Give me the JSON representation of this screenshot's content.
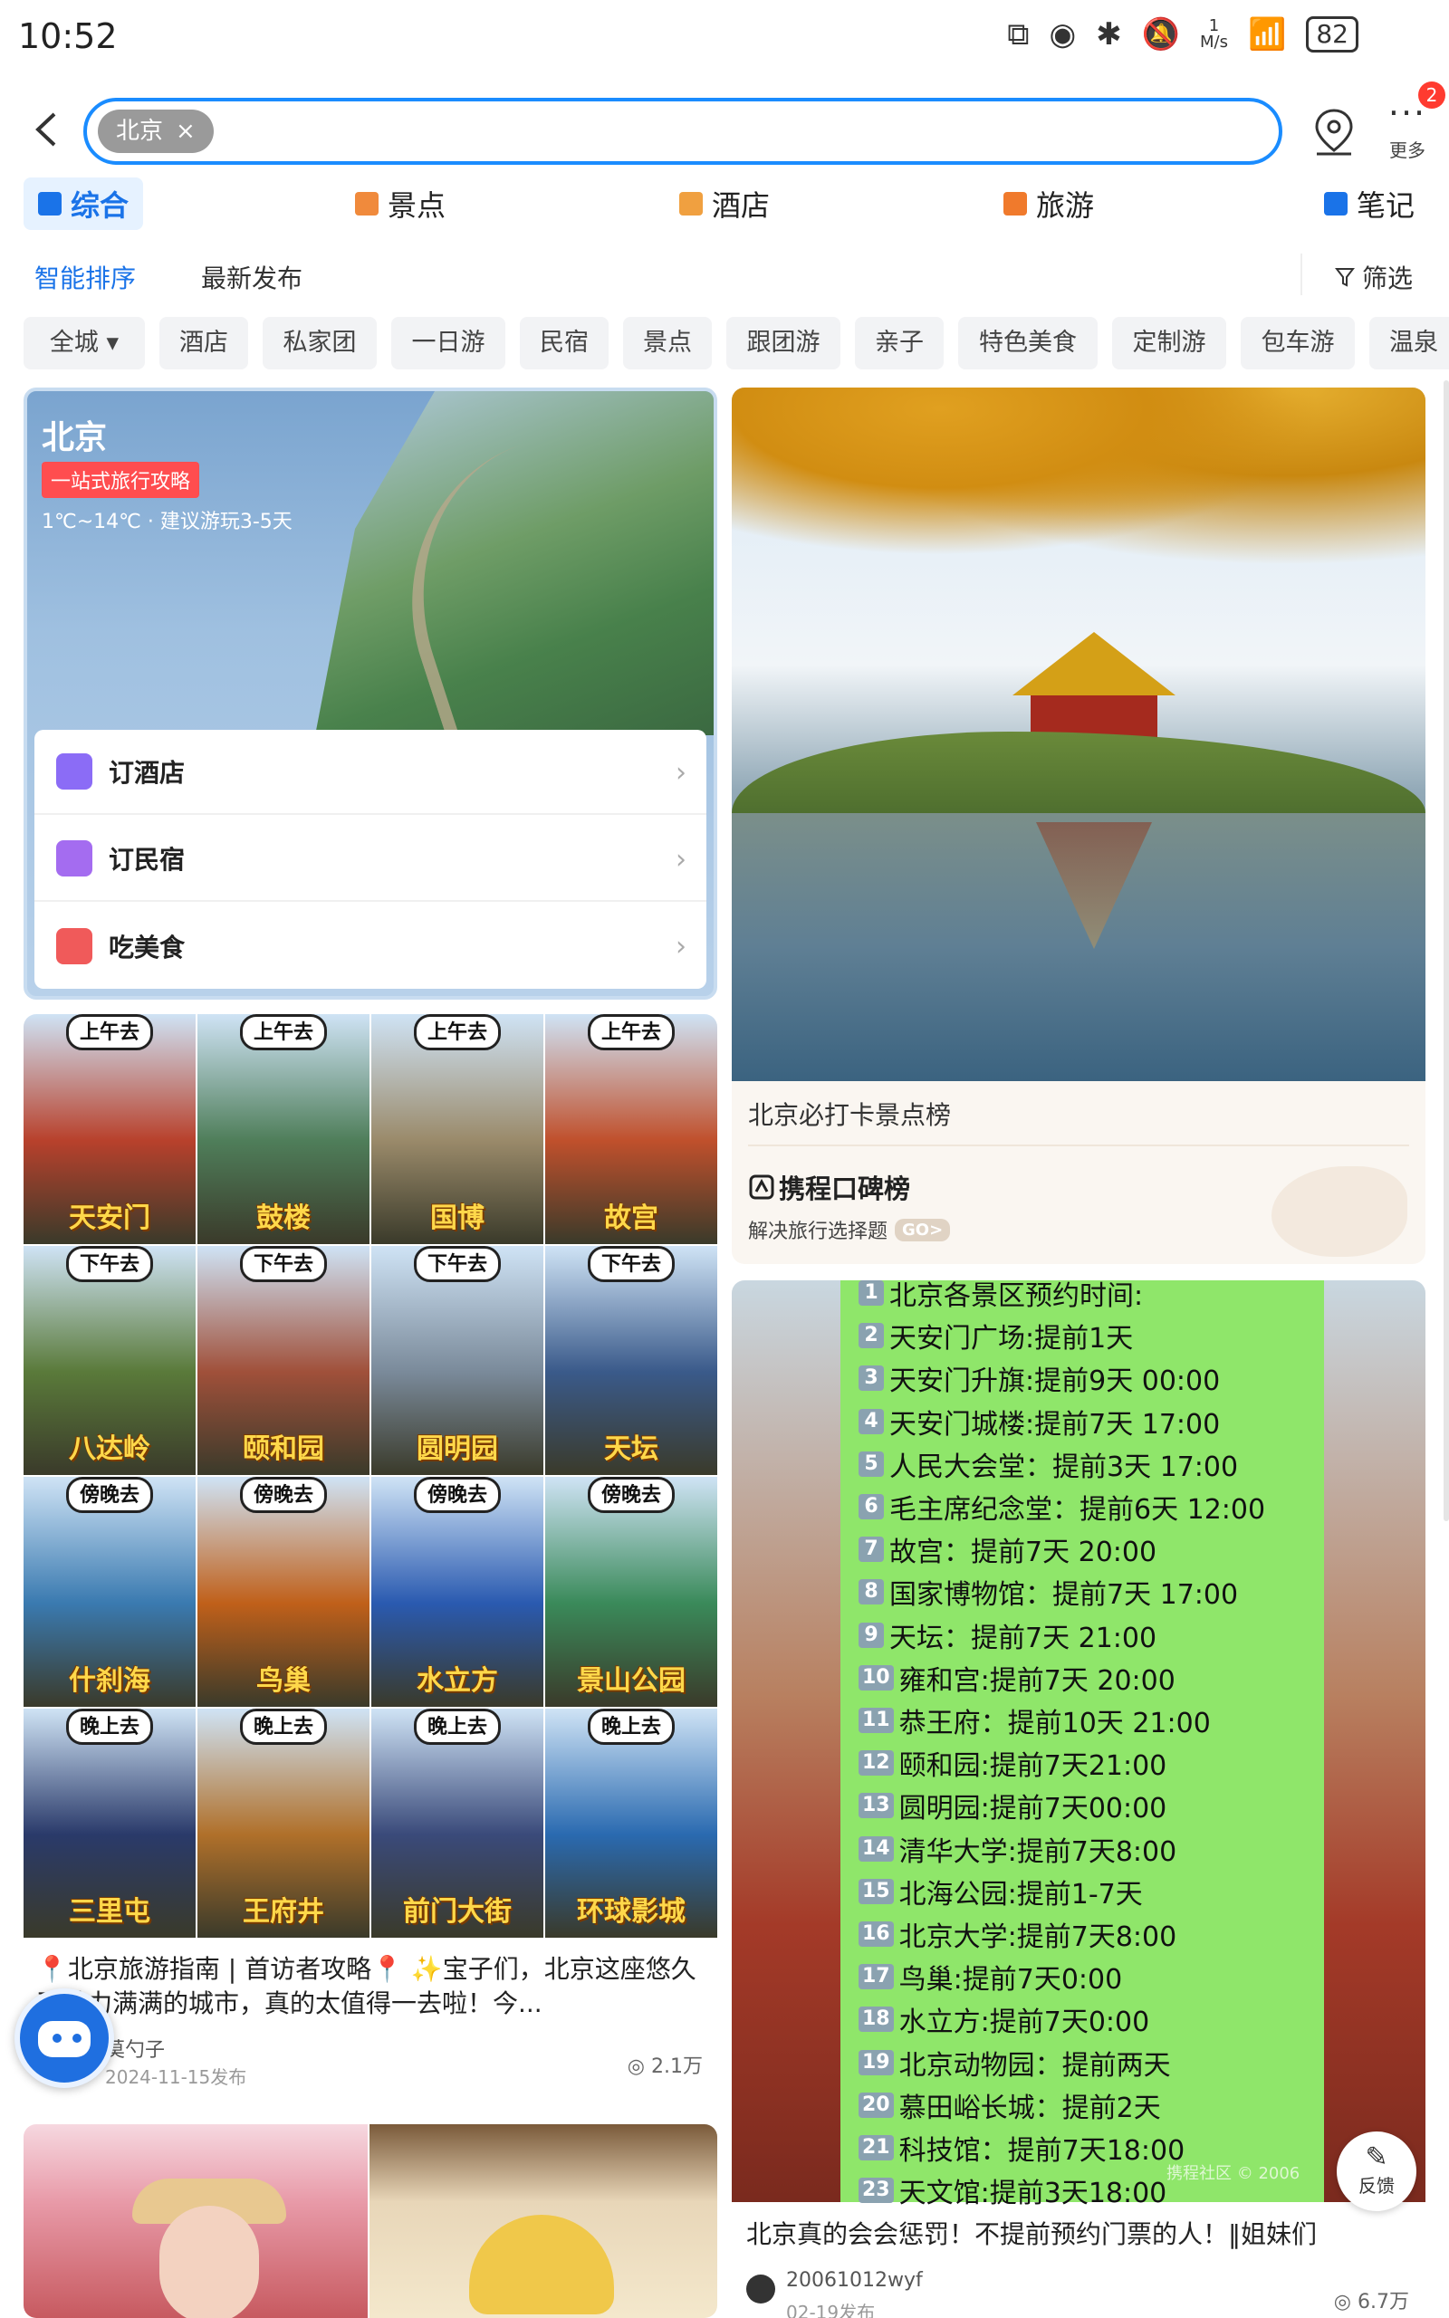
{
  "status_bar": {
    "time": "10:52",
    "net_speed_value": "1",
    "net_speed_unit": "M/s",
    "battery": "82"
  },
  "search": {
    "chip_label": "北京",
    "chip_close": "×"
  },
  "more": {
    "label": "更多",
    "badge": "2"
  },
  "category_tabs": [
    {
      "label": "综合",
      "active": true,
      "icon_color": "#1a73e8"
    },
    {
      "label": "景点",
      "icon_color": "#f08a3c"
    },
    {
      "label": "酒店",
      "icon_color": "#f0a040"
    },
    {
      "label": "旅游",
      "icon_color": "#f07a2c"
    },
    {
      "label": "笔记",
      "icon_color": "#1a73e8"
    }
  ],
  "sort": {
    "smart": "智能排序",
    "latest": "最新发布",
    "filter": "筛选"
  },
  "filter_chips": [
    "全城",
    "酒店",
    "私家团",
    "一日游",
    "民宿",
    "景点",
    "跟团游",
    "亲子",
    "特色美食",
    "定制游",
    "包车游",
    "温泉"
  ],
  "beijing_card": {
    "title": "北京",
    "tag": "一站式旅行攻略",
    "weather": "1℃~14℃ · 建议游玩3-5天",
    "links": [
      {
        "label": "订酒店",
        "icon_color": "#8b6cf6"
      },
      {
        "label": "订民宿",
        "icon_color": "#a46cf0"
      },
      {
        "label": "吃美食",
        "icon_color": "#f05a5a"
      }
    ]
  },
  "forbidden_card": {
    "title": "北京必打卡景点榜",
    "brand": "携程口碑榜",
    "subtitle": "解决旅行选择题",
    "go": "GO>"
  },
  "guide_card": {
    "tiles": [
      {
        "tag": "上午去",
        "name": "天安门",
        "color": "#b8412c"
      },
      {
        "tag": "上午去",
        "name": "鼓楼",
        "color": "#4f7e5a"
      },
      {
        "tag": "上午去",
        "name": "国博",
        "color": "#9a8a6a"
      },
      {
        "tag": "上午去",
        "name": "故宫",
        "color": "#c0502c"
      },
      {
        "tag": "下午去",
        "name": "八达岭",
        "color": "#5a7a3a"
      },
      {
        "tag": "下午去",
        "name": "颐和园",
        "color": "#a0503a"
      },
      {
        "tag": "下午去",
        "name": "圆明园",
        "color": "#7a8a9a"
      },
      {
        "tag": "下午去",
        "name": "天坛",
        "color": "#3a5a8a"
      },
      {
        "tag": "傍晚去",
        "name": "什刹海",
        "color": "#3a7ab0"
      },
      {
        "tag": "傍晚去",
        "name": "鸟巢",
        "color": "#c0601a"
      },
      {
        "tag": "傍晚去",
        "name": "水立方",
        "color": "#2a5ab0"
      },
      {
        "tag": "傍晚去",
        "name": "景山公园",
        "color": "#3a8a5a"
      },
      {
        "tag": "晚上去",
        "name": "三里屯",
        "color": "#2a3a6a"
      },
      {
        "tag": "晚上去",
        "name": "王府井",
        "color": "#b0702a"
      },
      {
        "tag": "晚上去",
        "name": "前门大街",
        "color": "#3a4a7a"
      },
      {
        "tag": "晚上去",
        "name": "环球影城",
        "color": "#2a6ab0"
      }
    ],
    "text": "📍北京旅游指南 | 首访者攻略📍 ✨宝子们，北京这座悠久又魅力满满的城市，真的太值得一去啦！今...",
    "author": "莫勺子",
    "date": "2024-11-15发布",
    "views": "2.1万"
  },
  "list_card": {
    "rows": [
      {
        "num": "1",
        "text": "北京各景区预约时间:"
      },
      {
        "num": "2",
        "text": "天安门广场:提前1天"
      },
      {
        "num": "3",
        "text": "天安门升旗:提前9天 00:00"
      },
      {
        "num": "4",
        "text": "天安门城楼:提前7天 17:00"
      },
      {
        "num": "5",
        "text": "人民大会堂：提前3天 17:00"
      },
      {
        "num": "6",
        "text": "毛主席纪念堂：提前6天 12:00"
      },
      {
        "num": "7",
        "text": "故宫：提前7天 20:00"
      },
      {
        "num": "8",
        "text": "国家博物馆：提前7天 17:00"
      },
      {
        "num": "9",
        "text": "天坛：提前7天 21:00"
      },
      {
        "num": "10",
        "text": "雍和宫:提前7天 20:00"
      },
      {
        "num": "11",
        "text": "恭王府：提前10天 21:00"
      },
      {
        "num": "12",
        "text": "颐和园:提前7天21:00"
      },
      {
        "num": "13",
        "text": "圆明园:提前7天00:00"
      },
      {
        "num": "14",
        "text": "清华大学:提前7天8:00"
      },
      {
        "num": "15",
        "text": "北海公园:提前1-7天"
      },
      {
        "num": "16",
        "text": "北京大学:提前7天8:00"
      },
      {
        "num": "17",
        "text": "鸟巢:提前7天0:00"
      },
      {
        "num": "18",
        "text": "水立方:提前7天0:00"
      },
      {
        "num": "19",
        "text": "北京动物园：提前两天"
      },
      {
        "num": "20",
        "text": "慕田峪长城：提前2天"
      },
      {
        "num": "21",
        "text": "科技馆：提前7天18:00"
      },
      {
        "num": "23",
        "text": "天文馆:提前3天18:00"
      }
    ],
    "watermark": "携程社区 © 2006",
    "title": "北京真的会会惩罚！不提前预约门票的人！‖姐妹们",
    "author": "20061012wyf",
    "date": "02-19发布",
    "views": "6.7万"
  },
  "feedback": {
    "label": "反馈"
  }
}
